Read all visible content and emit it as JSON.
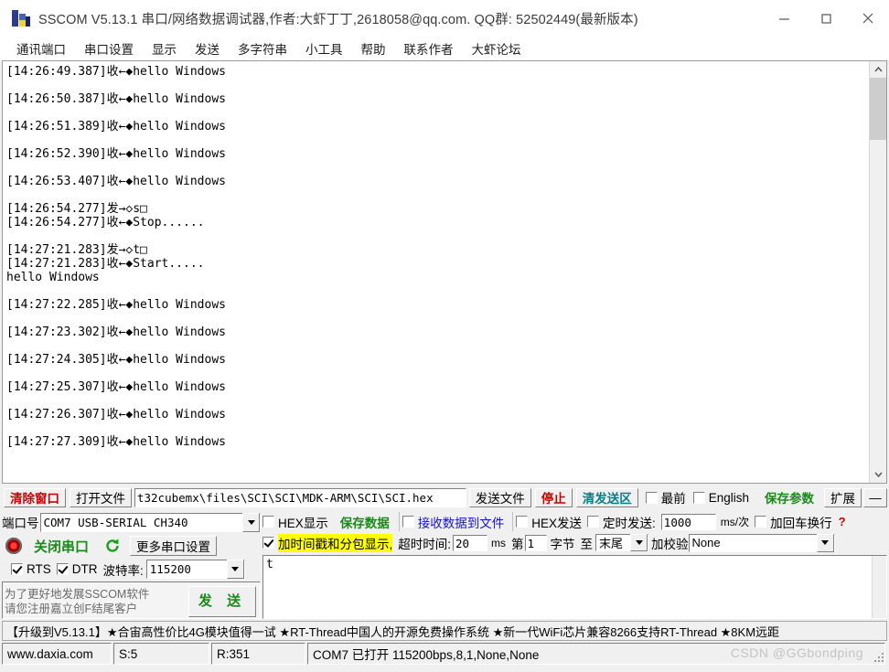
{
  "window": {
    "title": "SSCOM V5.13.1 串口/网络数据调试器,作者:大虾丁丁,2618058@qq.com. QQ群: 52502449(最新版本)",
    "minimize": "—",
    "maximize": "□",
    "close": "✕"
  },
  "menubar": {
    "items": [
      {
        "label": "通讯端口"
      },
      {
        "label": "串口设置"
      },
      {
        "label": "显示"
      },
      {
        "label": "发送"
      },
      {
        "label": "多字符串"
      },
      {
        "label": "小工具"
      },
      {
        "label": "帮助"
      },
      {
        "label": "联系作者"
      },
      {
        "label": "大虾论坛"
      }
    ]
  },
  "log": {
    "lines": [
      {
        "text": "[14:26:49.387]收←◆hello Windows",
        "gap": false
      },
      {
        "text": "[14:26:50.387]收←◆hello Windows",
        "gap": true
      },
      {
        "text": "[14:26:51.389]收←◆hello Windows",
        "gap": true
      },
      {
        "text": "[14:26:52.390]收←◆hello Windows",
        "gap": true
      },
      {
        "text": "[14:26:53.407]收←◆hello Windows",
        "gap": true
      },
      {
        "text": "[14:26:54.277]发→◇s□",
        "gap": true
      },
      {
        "text": "[14:26:54.277]收←◆Stop......",
        "gap": false
      },
      {
        "text": "[14:27:21.283]发→◇t□",
        "gap": true
      },
      {
        "text": "[14:27:21.283]收←◆Start.....",
        "gap": false
      },
      {
        "text": "hello Windows",
        "gap": false
      },
      {
        "text": "[14:27:22.285]收←◆hello Windows",
        "gap": true
      },
      {
        "text": "[14:27:23.302]收←◆hello Windows",
        "gap": true
      },
      {
        "text": "[14:27:24.305]收←◆hello Windows",
        "gap": true
      },
      {
        "text": "[14:27:25.307]收←◆hello Windows",
        "gap": true
      },
      {
        "text": "[14:27:26.307]收←◆hello Windows",
        "gap": true
      },
      {
        "text": "[14:27:27.309]收←◆hello Windows",
        "gap": true
      }
    ]
  },
  "toolbar": {
    "clear_window": "清除窗口",
    "open_file": "打开文件",
    "file_path": "t32cubemx\\files\\SCI\\SCI\\MDK-ARM\\SCI\\SCI.hex",
    "send_file": "发送文件",
    "stop": "停止",
    "clear_send": "清发送区",
    "topmost_label": "最前",
    "topmost_checked": false,
    "english_label": "English",
    "english_checked": false,
    "save_params": "保存参数",
    "extend": "扩展",
    "collapse": "—"
  },
  "serial": {
    "port_label": "端口号",
    "port_value": "COM7  USB-SERIAL CH340",
    "close_port": "关闭串口",
    "more_settings": "更多串口设置",
    "rts_label": "RTS",
    "rts_checked": true,
    "dtr_label": "DTR",
    "dtr_checked": true,
    "baud_label": "波特率:",
    "baud_value": "115200",
    "ad_line1": "为了更好地发展SSCOM软件",
    "ad_line2": "请您注册嘉立创F结尾客户",
    "send_button": "发 送"
  },
  "options": {
    "hex_display_label": "HEX显示",
    "hex_display_checked": false,
    "save_data": "保存数据",
    "recv_to_file_label": "接收数据到文件",
    "recv_to_file_checked": false,
    "hex_send_label": "HEX发送",
    "hex_send_checked": false,
    "timed_send_label": "定时发送:",
    "timed_send_checked": false,
    "timed_send_value": "1000",
    "timed_send_unit": "ms/次",
    "crlf_label": "加回车换行",
    "crlf_checked": false,
    "timestamp_label": "加时间戳和分包显示,",
    "timestamp_checked": true,
    "timeout_label": "超时时间:",
    "timeout_value": "20",
    "timeout_unit": "ms",
    "byte_from_label": "第",
    "byte_from_value": "1",
    "byte_mid_label": "字节",
    "byte_to_label": "至",
    "byte_to_value": "末尾",
    "checksum_label": "加校验",
    "checksum_value": "None",
    "help_mark": "?"
  },
  "send_area": {
    "text": "t"
  },
  "banner": {
    "text": "【升级到V5.13.1】★合宙高性价比4G模块值得一试  ★RT-Thread中国人的开源免费操作系统  ★新一代WiFi芯片兼容8266支持RT-Thread ★8KM远距"
  },
  "status": {
    "site": "www.daxia.com",
    "sent": "S:5",
    "received": "R:351",
    "connection": "COM7 已打开  115200bps,8,1,None,None",
    "watermark": "CSDN @GGbondping"
  },
  "colors": {
    "accent_red": "#cc0000",
    "accent_green": "#1a8a1a",
    "accent_teal": "#0a7d86",
    "highlight_yellow": "#ffff00",
    "link_blue": "#1414c8"
  }
}
